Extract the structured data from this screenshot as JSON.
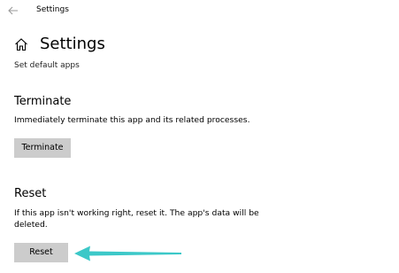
{
  "window": {
    "title": "Settings"
  },
  "header": {
    "title": "Settings",
    "link": "Set default apps"
  },
  "terminate": {
    "heading": "Terminate",
    "description": "Immediately terminate this app and its related processes.",
    "button_label": "Terminate"
  },
  "reset": {
    "heading": "Reset",
    "description": "If this app isn't working right, reset it. The app's data will be deleted.",
    "button_label": "Reset"
  },
  "icons": {
    "back": "back-arrow-icon",
    "home": "home-icon"
  },
  "colors": {
    "button_bg": "#cccccc",
    "annotation_arrow": "#3cc8c8"
  }
}
